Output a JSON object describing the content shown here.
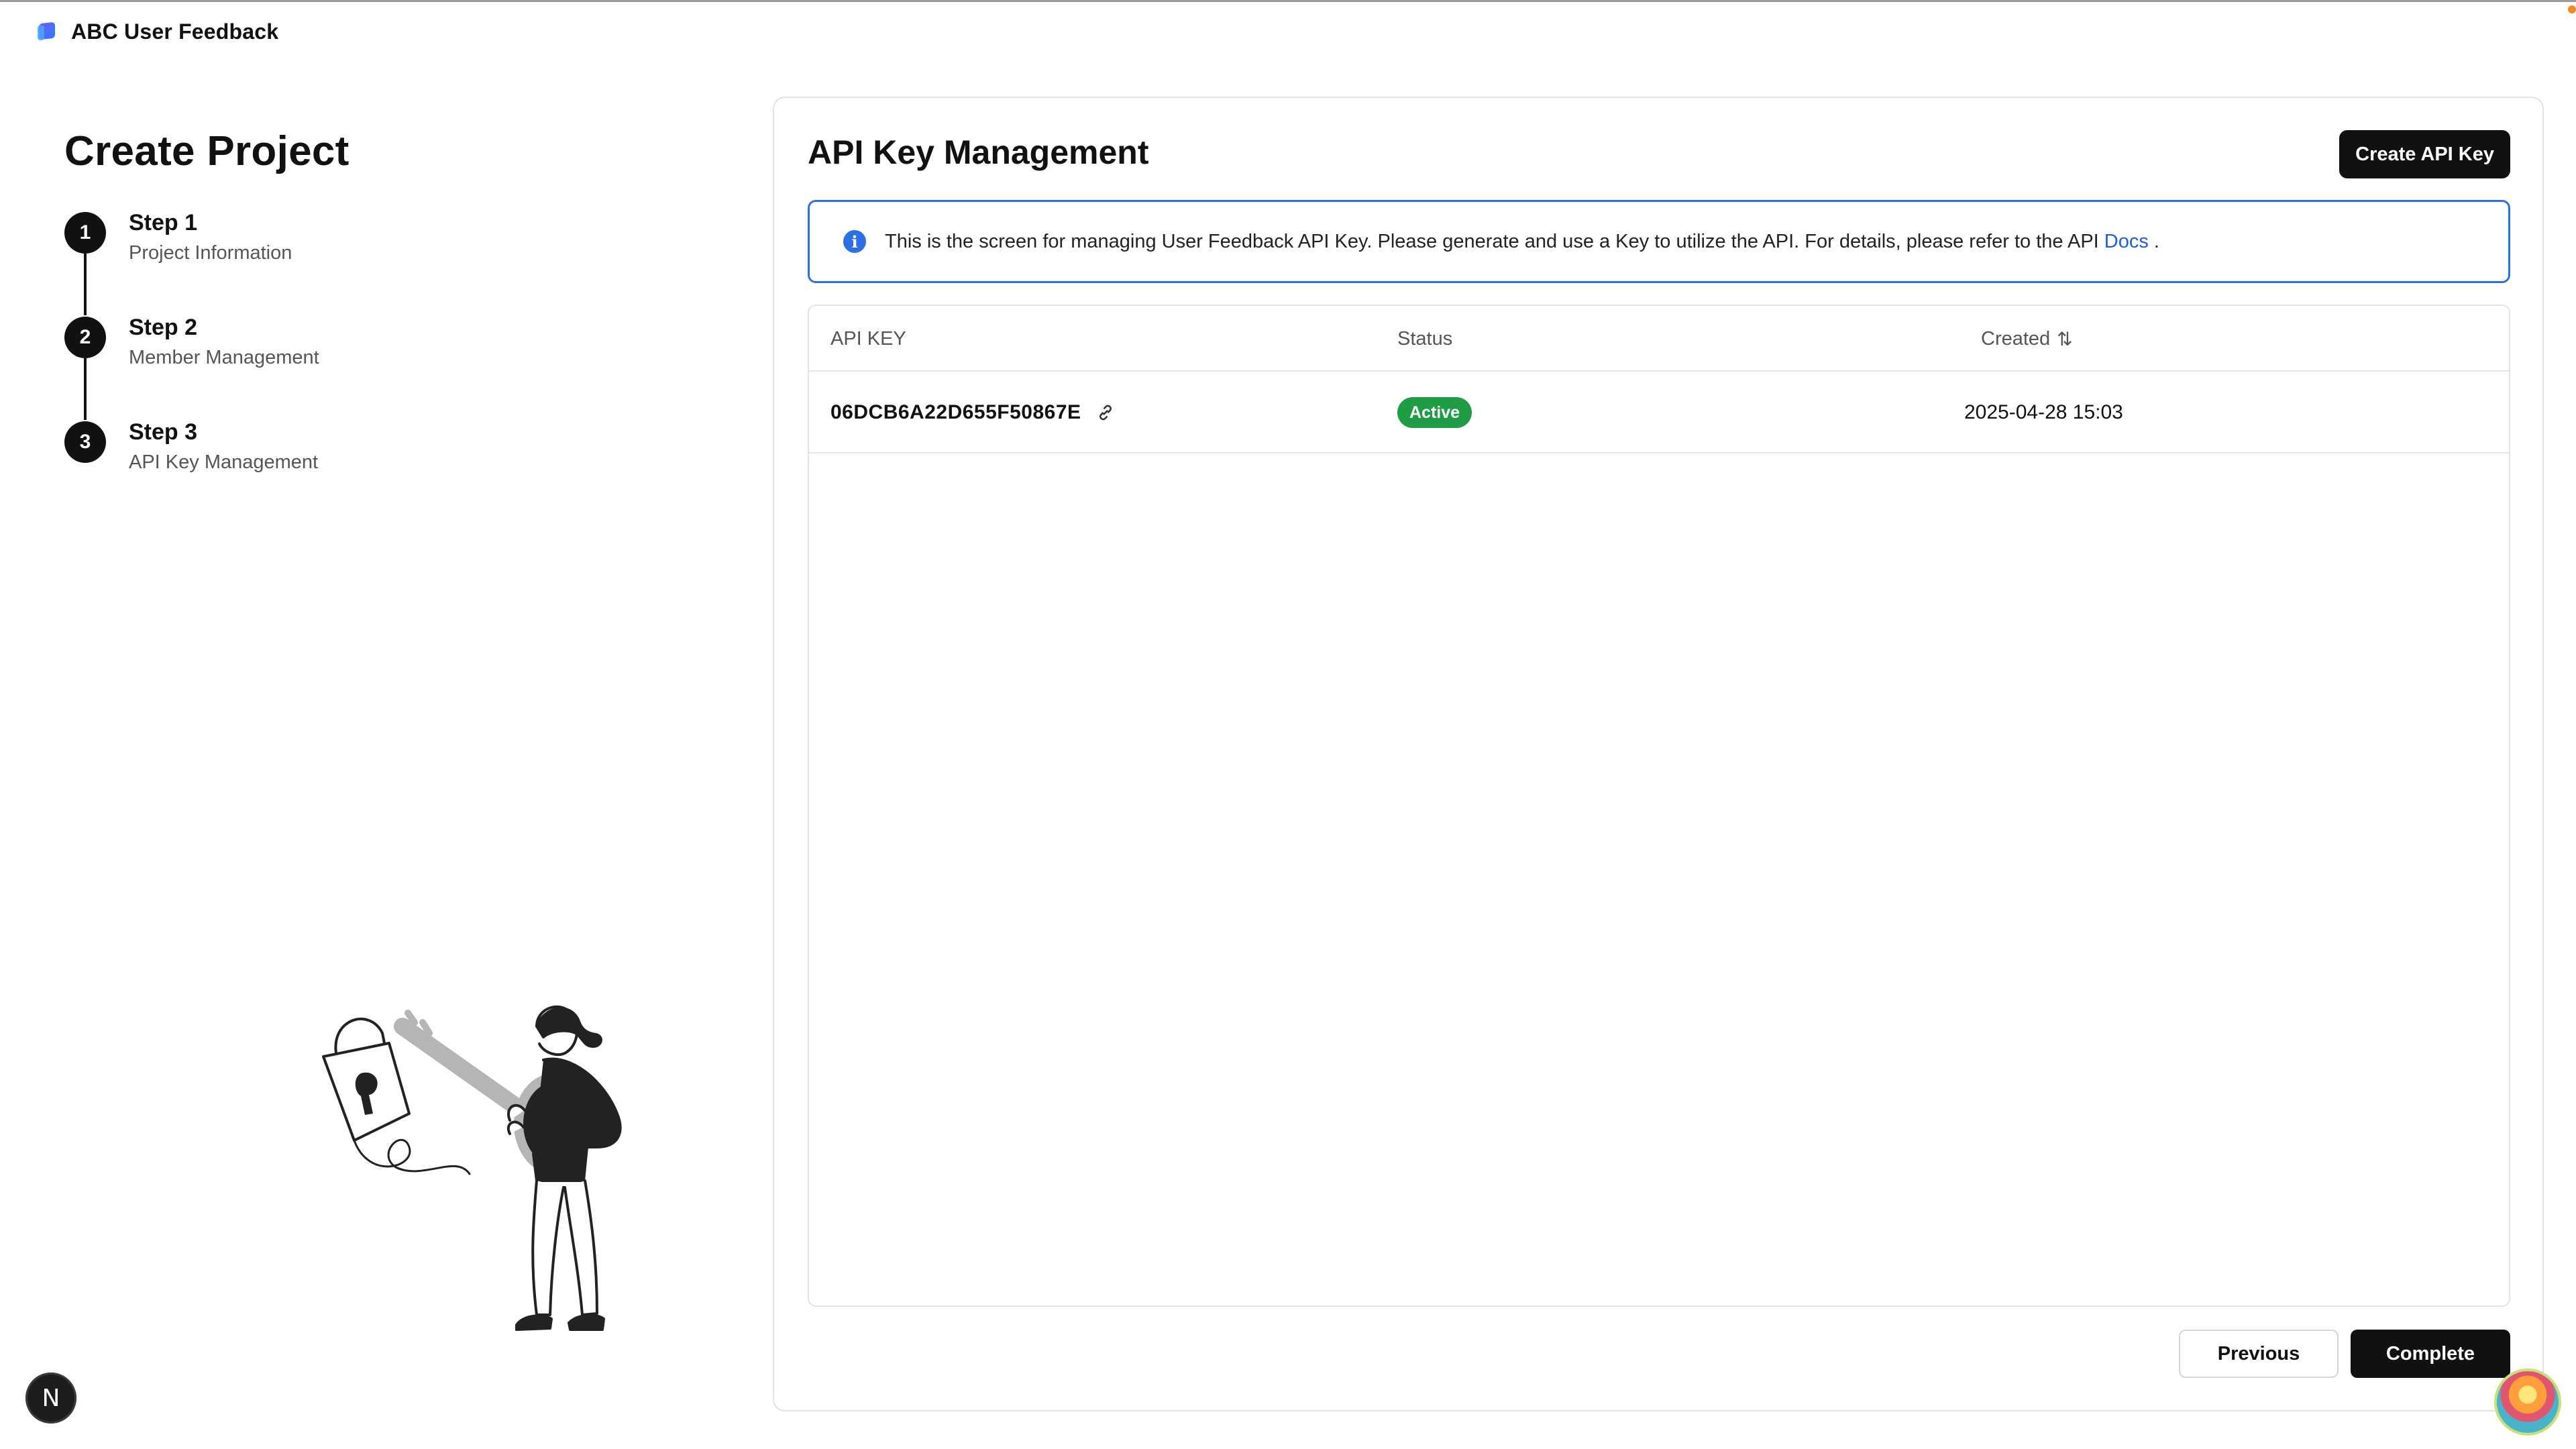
{
  "app": {
    "title": "ABC User Feedback"
  },
  "page": {
    "title": "Create Project"
  },
  "steps": [
    {
      "number": "1",
      "title": "Step 1",
      "subtitle": "Project Information"
    },
    {
      "number": "2",
      "title": "Step 2",
      "subtitle": "Member Management"
    },
    {
      "number": "3",
      "title": "Step 3",
      "subtitle": "API Key Management"
    }
  ],
  "main": {
    "title": "API Key Management",
    "create_button": "Create API Key",
    "info": {
      "text": "This is the screen for managing User Feedback API Key. Please generate and use a Key to utilize the API. For details, please refer to the API",
      "link": "Docs",
      "suffix": "."
    },
    "table": {
      "columns": [
        "API KEY",
        "Status",
        "Created"
      ],
      "rows": [
        {
          "api_key": "06DCB6A22D655F50867E",
          "status": "Active",
          "created": "2025-04-28 15:03"
        }
      ]
    },
    "previous_button": "Previous",
    "complete_button": "Complete"
  },
  "colors": {
    "accent": "#111111",
    "info_border": "#2f6fe4",
    "link": "#1f5fd6",
    "active_badge": "#1f9d45"
  },
  "icons": [
    "app-logo-icon",
    "info-icon",
    "link-icon",
    "sort-icon",
    "nextjs-n-icon"
  ],
  "badge": {
    "letter": "N"
  }
}
